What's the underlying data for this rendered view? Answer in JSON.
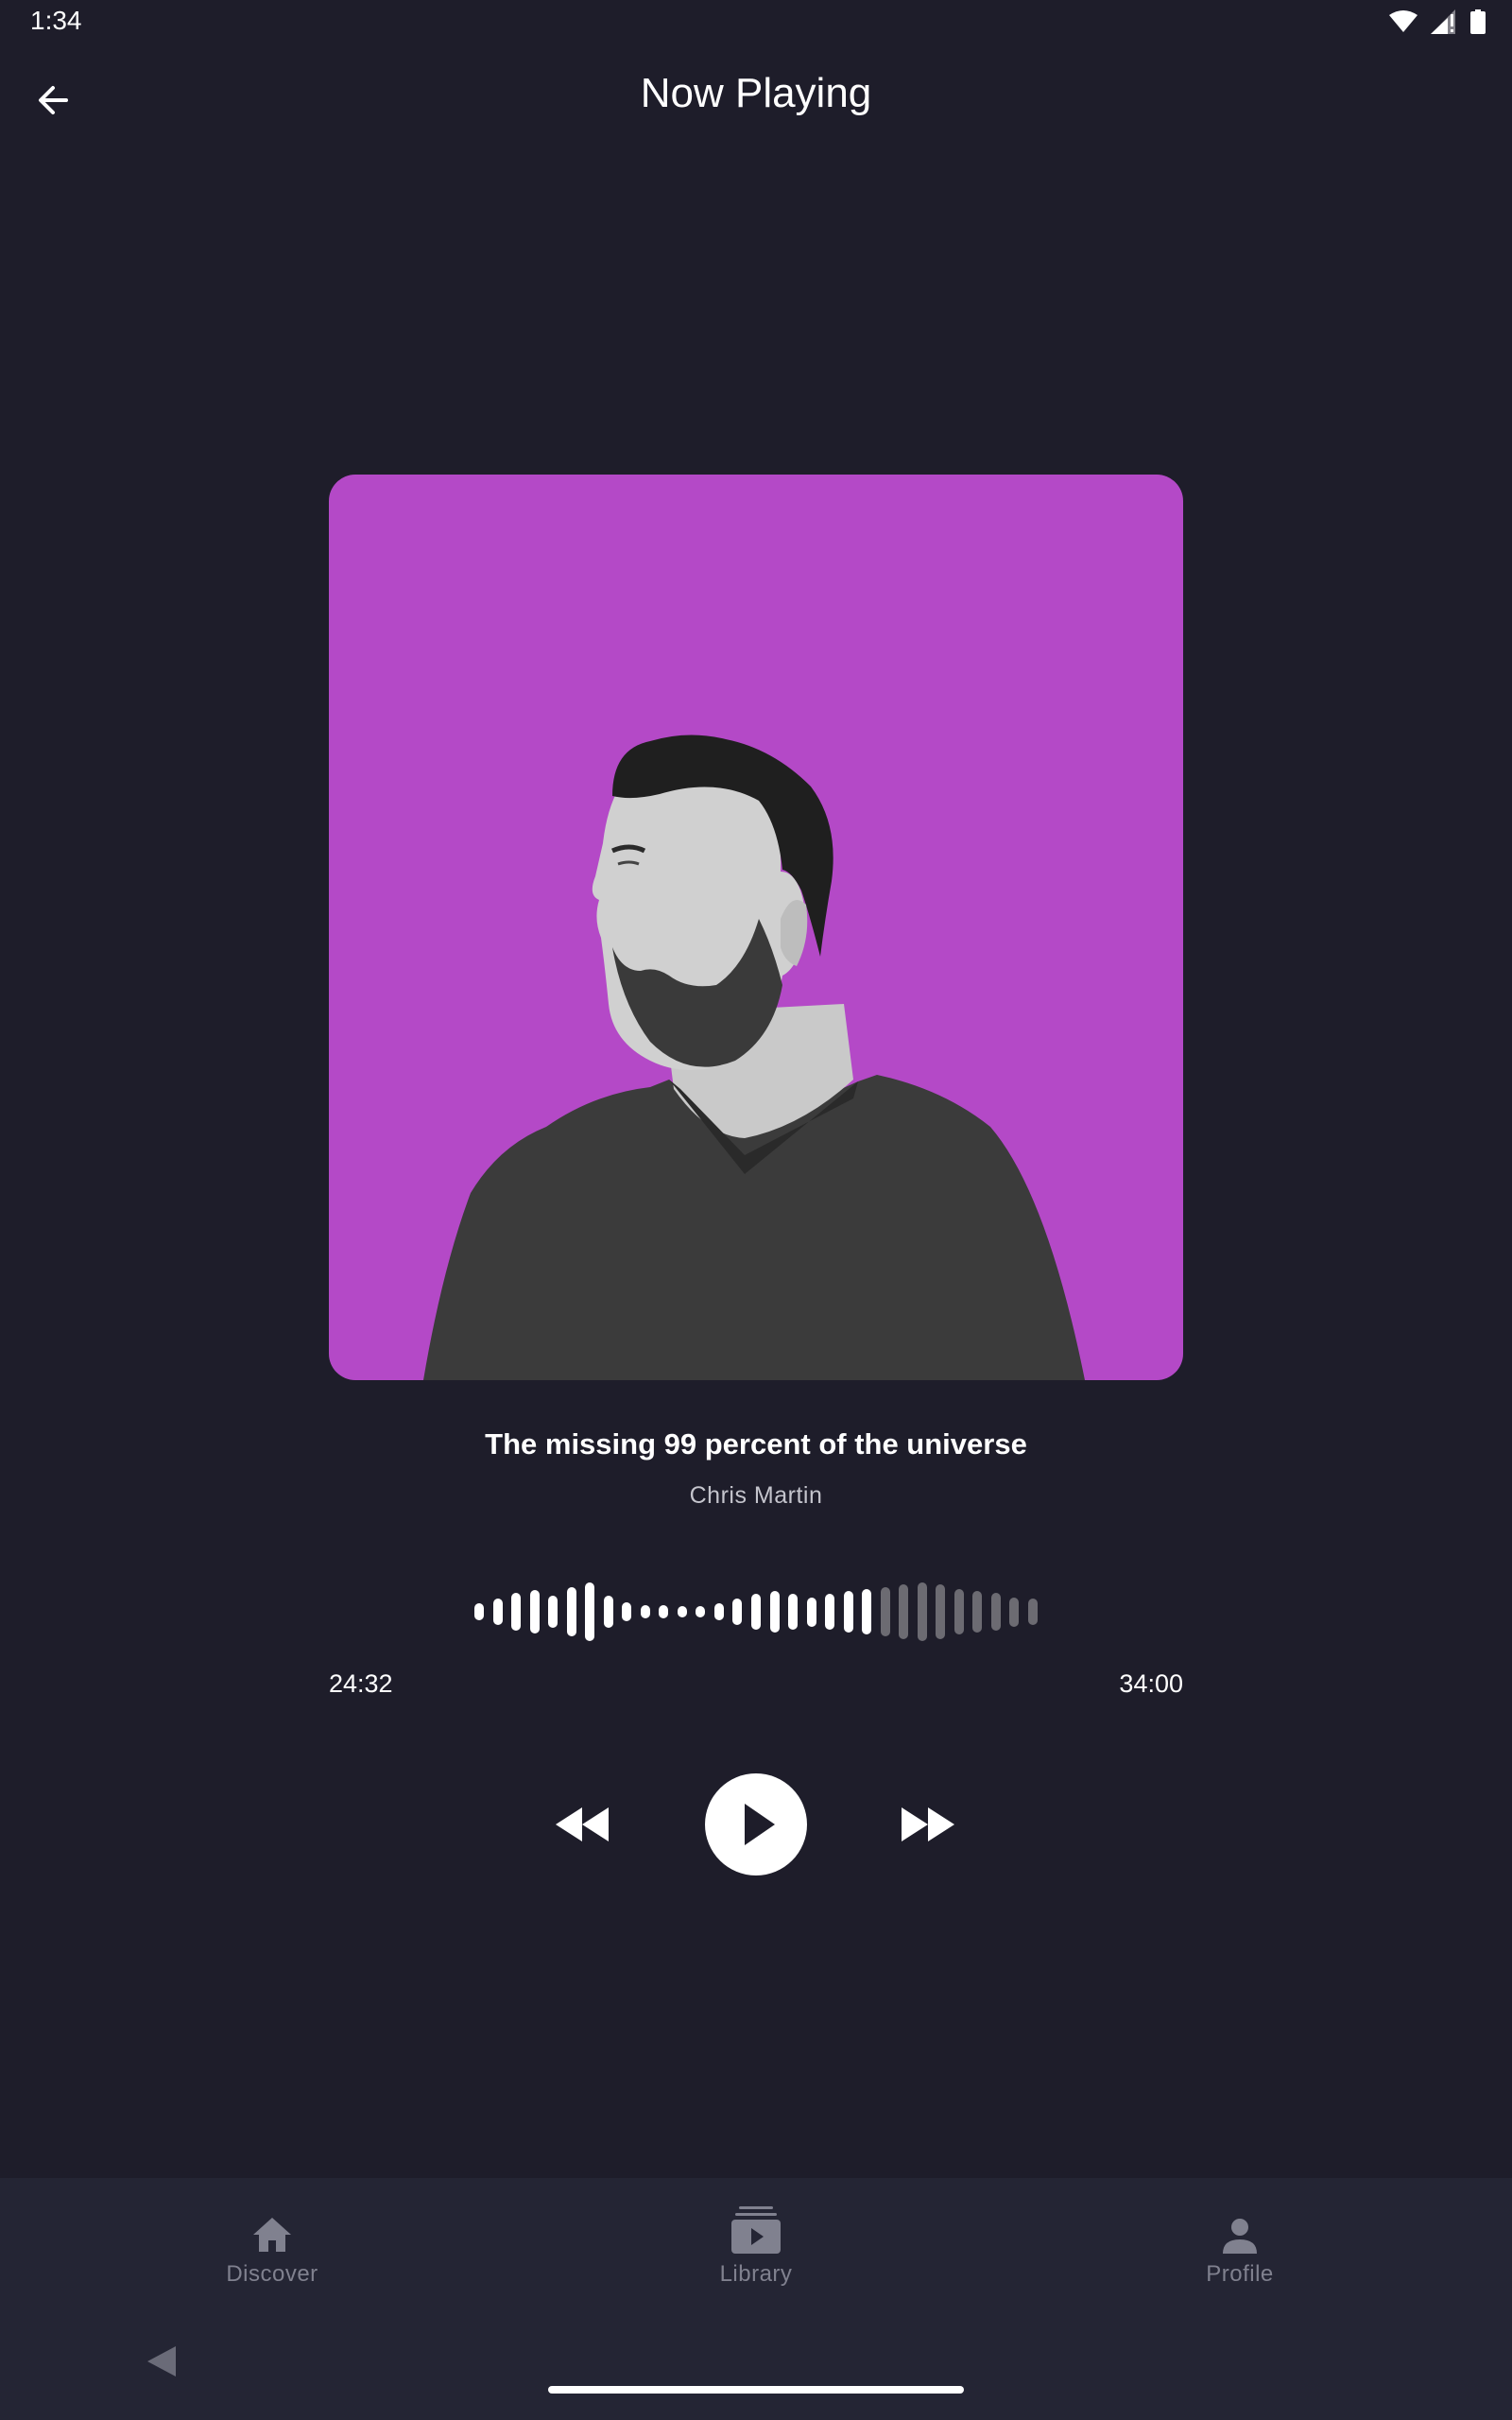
{
  "status_bar": {
    "time": "1:34",
    "icons": [
      "wifi-icon",
      "signal-icon",
      "battery-icon"
    ]
  },
  "header": {
    "title": "Now Playing",
    "back_icon": "arrow-left-icon"
  },
  "artwork": {
    "background_color": "#b449c7",
    "subject": "grayscale portrait of bearded man in dark v-neck t-shirt"
  },
  "track": {
    "title": "The missing 99 percent of the universe",
    "artist": "Chris Martin"
  },
  "player": {
    "elapsed": "24:32",
    "total": "34:00",
    "progress_fraction": 0.72,
    "waveform_levels": [
      0.3,
      0.45,
      0.65,
      0.75,
      0.55,
      0.85,
      1.0,
      0.55,
      0.32,
      0.22,
      0.22,
      0.2,
      0.2,
      0.3,
      0.45,
      0.62,
      0.7,
      0.62,
      0.5,
      0.6,
      0.7,
      0.78,
      0.85,
      0.92,
      1.0,
      0.92,
      0.78,
      0.72,
      0.65,
      0.5,
      0.45
    ],
    "played_color": "#ffffff",
    "unplayed_color": "#6c6b72",
    "rewind_icon": "rewind-icon",
    "play_icon": "play-icon",
    "forward_icon": "fast-forward-icon"
  },
  "bottom_nav": {
    "items": [
      {
        "label": "Discover",
        "icon": "home-icon"
      },
      {
        "label": "Library",
        "icon": "library-icon"
      },
      {
        "label": "Profile",
        "icon": "person-icon"
      }
    ],
    "inactive_color": "#80818f"
  }
}
